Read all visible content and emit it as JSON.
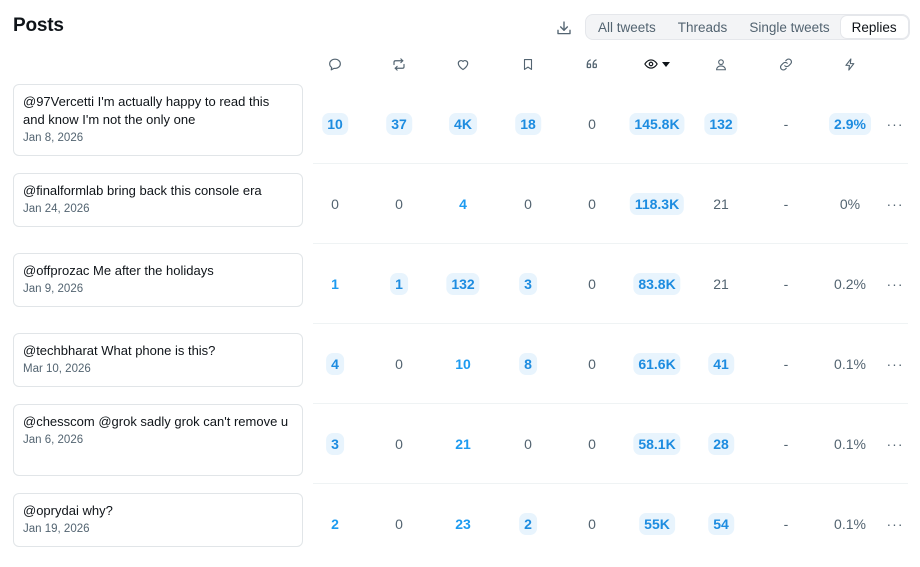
{
  "header": {
    "title": "Posts",
    "filters": [
      "All tweets",
      "Threads",
      "Single tweets",
      "Replies"
    ],
    "active_filter": "Replies"
  },
  "columns": [
    {
      "icon": "reply-icon"
    },
    {
      "icon": "retweet-icon"
    },
    {
      "icon": "like-icon"
    },
    {
      "icon": "bookmark-icon"
    },
    {
      "icon": "quote-icon"
    },
    {
      "icon": "impressions-icon",
      "sorted": "desc"
    },
    {
      "icon": "profile-visits-icon"
    },
    {
      "icon": "link-clicks-icon"
    },
    {
      "icon": "engagement-rate-icon"
    }
  ],
  "rows": [
    {
      "text": "@97Vercetti I'm actually happy to read this and know I'm not the only one",
      "date": "Jan 8, 2026",
      "cells": [
        {
          "v": "10",
          "s": "pill"
        },
        {
          "v": "37",
          "s": "pill"
        },
        {
          "v": "4K",
          "s": "pill"
        },
        {
          "v": "18",
          "s": "pill"
        },
        {
          "v": "0",
          "s": "plain"
        },
        {
          "v": "145.8K",
          "s": "pill"
        },
        {
          "v": "132",
          "s": "pill"
        },
        {
          "v": "-",
          "s": "dash"
        },
        {
          "v": "2.9%",
          "s": "pill"
        }
      ]
    },
    {
      "text": "@finalformlab bring back this console era",
      "date": "Jan 24, 2026",
      "cells": [
        {
          "v": "0",
          "s": "plain"
        },
        {
          "v": "0",
          "s": "plain"
        },
        {
          "v": "4",
          "s": "link"
        },
        {
          "v": "0",
          "s": "plain"
        },
        {
          "v": "0",
          "s": "plain"
        },
        {
          "v": "118.3K",
          "s": "pill"
        },
        {
          "v": "21",
          "s": "plain"
        },
        {
          "v": "-",
          "s": "dash"
        },
        {
          "v": "0%",
          "s": "plain"
        }
      ]
    },
    {
      "text": "@offprozac Me after the holidays",
      "date": "Jan 9, 2026",
      "cells": [
        {
          "v": "1",
          "s": "link"
        },
        {
          "v": "1",
          "s": "pill"
        },
        {
          "v": "132",
          "s": "pill"
        },
        {
          "v": "3",
          "s": "pill"
        },
        {
          "v": "0",
          "s": "plain"
        },
        {
          "v": "83.8K",
          "s": "pill"
        },
        {
          "v": "21",
          "s": "plain"
        },
        {
          "v": "-",
          "s": "dash"
        },
        {
          "v": "0.2%",
          "s": "plain"
        }
      ]
    },
    {
      "text": "@techbharat What phone is this?",
      "date": "Mar 10, 2026",
      "cells": [
        {
          "v": "4",
          "s": "pill"
        },
        {
          "v": "0",
          "s": "plain"
        },
        {
          "v": "10",
          "s": "link"
        },
        {
          "v": "8",
          "s": "pill"
        },
        {
          "v": "0",
          "s": "plain"
        },
        {
          "v": "61.6K",
          "s": "pill"
        },
        {
          "v": "41",
          "s": "pill"
        },
        {
          "v": "-",
          "s": "dash"
        },
        {
          "v": "0.1%",
          "s": "plain"
        }
      ]
    },
    {
      "text": "@chesscom @grok sadly grok can't remove u",
      "date": "Jan 6, 2026",
      "cells": [
        {
          "v": "3",
          "s": "pill"
        },
        {
          "v": "0",
          "s": "plain"
        },
        {
          "v": "21",
          "s": "link"
        },
        {
          "v": "0",
          "s": "plain"
        },
        {
          "v": "0",
          "s": "plain"
        },
        {
          "v": "58.1K",
          "s": "pill"
        },
        {
          "v": "28",
          "s": "pill"
        },
        {
          "v": "-",
          "s": "dash"
        },
        {
          "v": "0.1%",
          "s": "plain"
        }
      ]
    },
    {
      "text": "@oprydai why?",
      "date": "Jan 19, 2026",
      "cells": [
        {
          "v": "2",
          "s": "link"
        },
        {
          "v": "0",
          "s": "plain"
        },
        {
          "v": "23",
          "s": "link"
        },
        {
          "v": "2",
          "s": "pill"
        },
        {
          "v": "0",
          "s": "plain"
        },
        {
          "v": "55K",
          "s": "pill"
        },
        {
          "v": "54",
          "s": "pill"
        },
        {
          "v": "-",
          "s": "dash"
        },
        {
          "v": "0.1%",
          "s": "plain"
        }
      ]
    }
  ],
  "more_label": "···",
  "colors": {
    "accent": "#1d9bf0",
    "pill_bg": "#e8f4fd",
    "muted": "#536471"
  }
}
